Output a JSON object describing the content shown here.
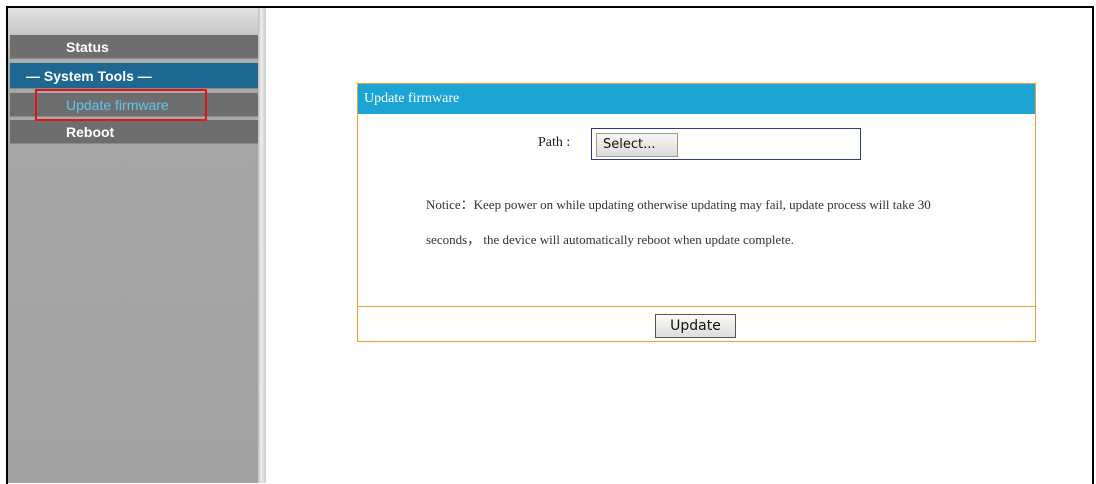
{
  "sidebar": {
    "items": [
      {
        "label": "Status"
      },
      {
        "label": "— System Tools —"
      },
      {
        "label": "Update firmware"
      },
      {
        "label": "Reboot"
      }
    ]
  },
  "panel": {
    "title": "Update firmware",
    "path_label": "Path :",
    "select_button": "Select...",
    "notice": "Notice：Keep power on while updating otherwise updating may fail, update process will take 30 seconds， the device will automatically reboot when update complete.",
    "update_button": "Update"
  },
  "colors": {
    "sidebar_header": "#1d6890",
    "panel_title_bg": "#1ca5d4",
    "panel_border": "#f0a030",
    "active_item_text": "#5fc6ec",
    "highlight_box": "#e01616"
  }
}
